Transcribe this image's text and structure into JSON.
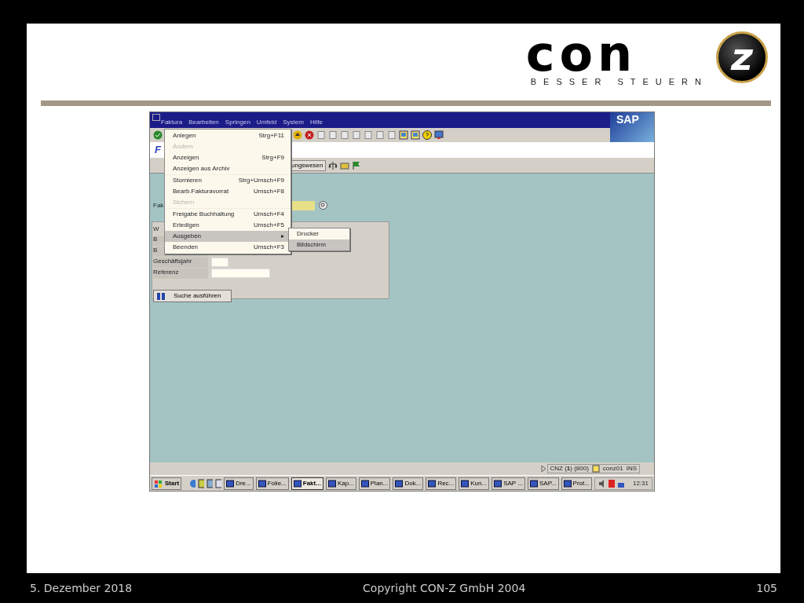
{
  "logo": {
    "wordmark": "con",
    "emblem": "z",
    "tagline": "BESSER STEUERN"
  },
  "sap_window": {
    "menu_bar": [
      "Faktura",
      "Bearbeiten",
      "Springen",
      "Umfeld",
      "System",
      "Hilfe"
    ],
    "sap_logo": "SAP",
    "title": "F",
    "app_toolbar_button": "ungswesen",
    "selection_label": "Fak",
    "group": {
      "title": "W",
      "rows": [
        {
          "label": "B",
          "kind": "hidden"
        },
        {
          "label": "B",
          "kind": "hidden"
        },
        {
          "label": "Geschäftsjahr",
          "kind": "short"
        },
        {
          "label": "Referenz",
          "kind": "long"
        }
      ]
    },
    "search_button": "Suche ausführen",
    "dropdown": [
      {
        "kind": "item",
        "label": "Anlegen",
        "shortcut": "Strg+F11",
        "disabled": false,
        "selected": false
      },
      {
        "kind": "item",
        "label": "Ändern",
        "disabled": true,
        "selected": false
      },
      {
        "kind": "item",
        "label": "Anzeigen",
        "shortcut": "Strg+F9",
        "disabled": false,
        "selected": false
      },
      {
        "kind": "item",
        "label": "Anzeigen aus Archiv",
        "disabled": false,
        "selected": false
      },
      {
        "kind": "separator"
      },
      {
        "kind": "item",
        "label": "Stornieren",
        "shortcut": "Strg+Umsch+F9",
        "disabled": false,
        "selected": false
      },
      {
        "kind": "item",
        "label": "Bearb.Fakturavorrat",
        "shortcut": "Umsch+F8",
        "disabled": false,
        "selected": false
      },
      {
        "kind": "item",
        "label": "Sichern",
        "disabled": true,
        "selected": false
      },
      {
        "kind": "separator"
      },
      {
        "kind": "item",
        "label": "Freigabe Buchhaltung",
        "shortcut": "Umsch+F4",
        "disabled": false,
        "selected": false
      },
      {
        "kind": "item",
        "label": "Erledigen",
        "shortcut": "Umsch+F5",
        "disabled": false,
        "selected": false
      },
      {
        "kind": "item",
        "label": "Ausgeben",
        "submenu_arrow": "▸",
        "disabled": false,
        "selected": true
      },
      {
        "kind": "item",
        "label": "Beenden",
        "shortcut": "Umsch+F3",
        "disabled": false,
        "selected": false
      }
    ],
    "submenu": [
      {
        "label": "Drucker",
        "selected": false
      },
      {
        "label": "Bildschirm",
        "selected": true
      }
    ],
    "status": {
      "system": "CNZ (**1**) (800)",
      "user": "conz01",
      "mode": "INS"
    },
    "taskbar": {
      "start": "Start",
      "tasks": [
        {
          "label": "Dre...",
          "selected": false
        },
        {
          "label": "Folie...",
          "selected": false
        },
        {
          "label": "Fakt...",
          "selected": true
        },
        {
          "label": "Kap...",
          "selected": false
        },
        {
          "label": "Plan...",
          "selected": false
        },
        {
          "label": "Dok...",
          "selected": false
        },
        {
          "label": "Rec...",
          "selected": false
        },
        {
          "label": "Kun...",
          "selected": false
        },
        {
          "label": "SAP ...",
          "selected": false
        },
        {
          "label": "SAP...",
          "selected": false
        },
        {
          "label": "Prot...",
          "selected": false
        }
      ],
      "clock": "12:31"
    }
  },
  "footer": {
    "date": "5. Dezember 2018",
    "copyright": "Copyright CON-Z GmbH 2004",
    "page": "105"
  }
}
